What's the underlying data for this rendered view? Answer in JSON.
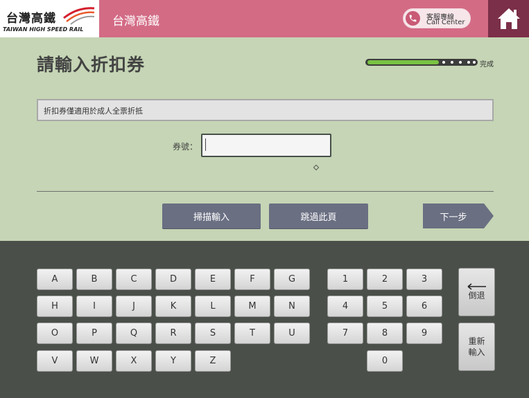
{
  "header": {
    "logo_cn": "台灣高鐵",
    "logo_en": "TAIWAN HIGH SPEED RAIL",
    "title": "台灣高鐵",
    "call_center_cn": "客服專線",
    "call_center_en": "Call Center",
    "home_icon": "home-icon"
  },
  "page": {
    "title": "請輸入折扣券",
    "progress_label": "完成",
    "progress_fraction": 0.66,
    "notice": "折扣券僅適用於成人全票折抵",
    "voucher_label": "券號：",
    "voucher_value": ""
  },
  "actions": {
    "scan": "掃描輸入",
    "skip": "跳過此頁",
    "next": "下一步"
  },
  "keyboard": {
    "row1": [
      "A",
      "B",
      "C",
      "D",
      "E",
      "F",
      "G"
    ],
    "row2": [
      "H",
      "I",
      "J",
      "K",
      "L",
      "M",
      "N"
    ],
    "row3": [
      "O",
      "P",
      "Q",
      "R",
      "S",
      "T",
      "U"
    ],
    "row4": [
      "V",
      "W",
      "X",
      "Y",
      "Z"
    ],
    "numrow1": [
      "1",
      "2",
      "3"
    ],
    "numrow2": [
      "4",
      "5",
      "6"
    ],
    "numrow3": [
      "7",
      "8",
      "9"
    ],
    "zero": "0",
    "backspace": "倒退",
    "backspace_icon": "arrow-left-icon",
    "reset_line1": "重新",
    "reset_line2": "輸入"
  },
  "colors": {
    "header": "#d36b85",
    "home": "#7b2f48",
    "main_bg": "#c5d5b5",
    "keyboard_bg": "#4a5049",
    "button": "#6a6f82",
    "progress": "#79c243"
  }
}
